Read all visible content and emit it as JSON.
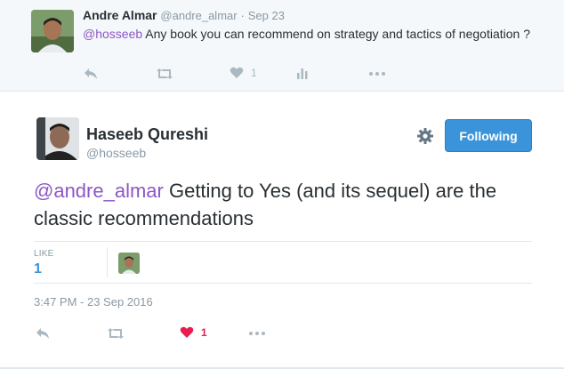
{
  "parent_tweet": {
    "name": "Andre Almar",
    "handle": "@andre_almar",
    "separator": "·",
    "date": "Sep 23",
    "mention": "@hosseeb",
    "text": " Any book you can recommend on strategy and tactics of negotiation ?",
    "like_count": "1",
    "avatar_icon": "user-photo"
  },
  "main_tweet": {
    "name": "Haseeb Qureshi",
    "handle": "@hosseeb",
    "follow_label": "Following",
    "mention": "@andre_almar",
    "text": " Getting to Yes (and its sequel) are the classic recommendations",
    "stats": {
      "like_label": "LIKE",
      "like_value": "1"
    },
    "timestamp": "3:47 PM - 23 Sep 2016",
    "like_count": "1",
    "avatar_icon": "user-photo"
  },
  "colors": {
    "accent": "#3b94d9",
    "mention": "#8c56c5",
    "liked": "#e81c4f",
    "muted": "#aab8c2"
  }
}
